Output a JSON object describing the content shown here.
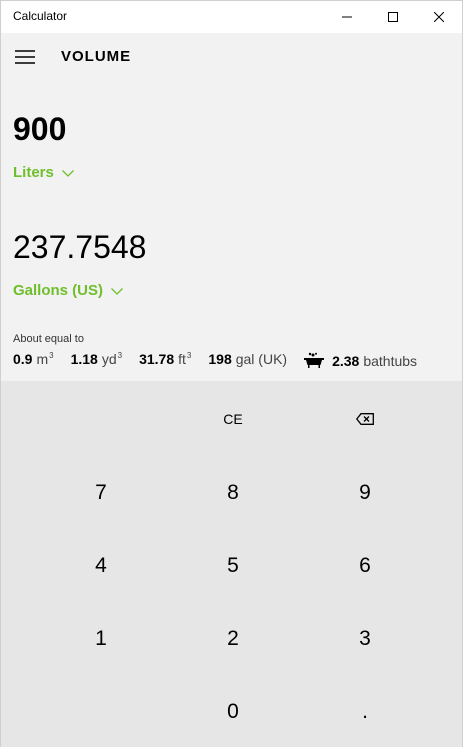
{
  "window": {
    "title": "Calculator",
    "icons": {
      "minimize": "minimize-icon",
      "maximize": "maximize-icon",
      "close": "close-icon"
    }
  },
  "header": {
    "menu_icon": "hamburger-icon",
    "title": "VOLUME"
  },
  "converter": {
    "from_value": "900",
    "from_unit": "Liters",
    "to_value": "237.7548",
    "to_unit": "Gallons (US)",
    "accent_color": "#6fbf2c"
  },
  "about": {
    "label": "About equal to",
    "items": [
      {
        "num": "0.9",
        "unit": "m",
        "sup": "3"
      },
      {
        "num": "1.18",
        "unit": "yd",
        "sup": "3"
      },
      {
        "num": "31.78",
        "unit": "ft",
        "sup": "3"
      },
      {
        "num": "198",
        "unit": "gal (UK)",
        "sup": ""
      },
      {
        "num": "2.38",
        "unit": "bathtubs",
        "sup": "",
        "icon": "bathtub-icon"
      }
    ]
  },
  "keypad": {
    "ce": "CE",
    "backspace_icon": "backspace-icon",
    "keys": [
      "7",
      "8",
      "9",
      "4",
      "5",
      "6",
      "1",
      "2",
      "3",
      "0",
      "."
    ]
  }
}
